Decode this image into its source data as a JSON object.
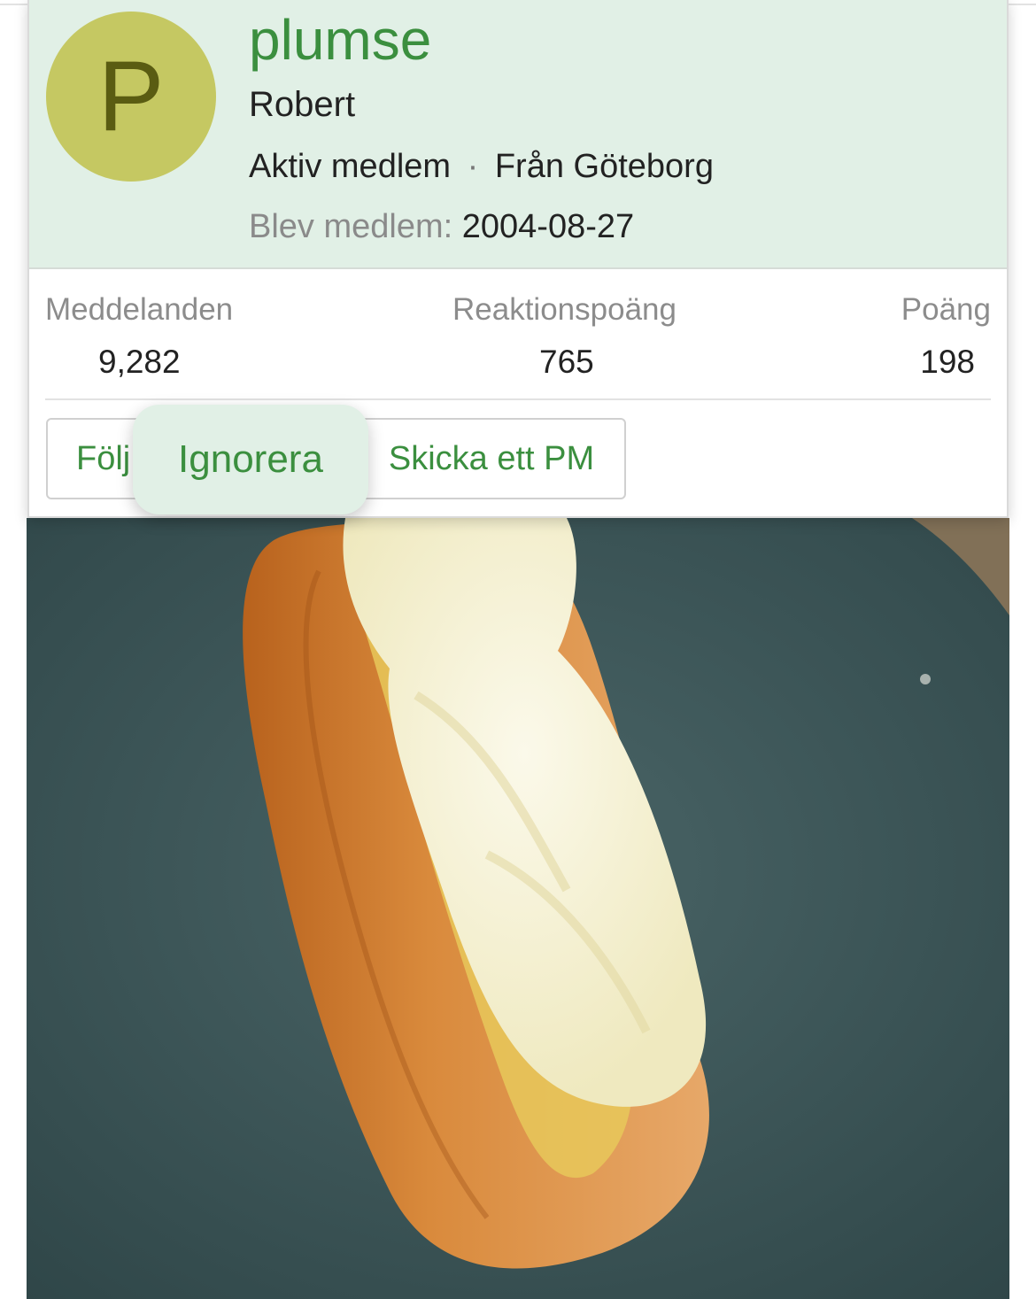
{
  "member": {
    "avatar_letter": "P",
    "username": "plumse",
    "real_name": "Robert",
    "role": "Aktiv medlem",
    "separator": "·",
    "location": "Från Göteborg",
    "joined_label": "Blev medlem:",
    "joined_date": "2004-08-27"
  },
  "stats": [
    {
      "label": "Meddelanden",
      "value": "9,282"
    },
    {
      "label": "Reaktionspoäng",
      "value": "765"
    },
    {
      "label": "Poäng",
      "value": "198"
    }
  ],
  "actions": {
    "follow": "Följ",
    "ignore": "Ignorera",
    "message": "Skicka ett PM"
  },
  "colors": {
    "accent_green": "#3b8f3f",
    "header_bg": "#e1f0e6",
    "avatar_bg": "#c5c862",
    "avatar_letter": "#5a5c12"
  }
}
